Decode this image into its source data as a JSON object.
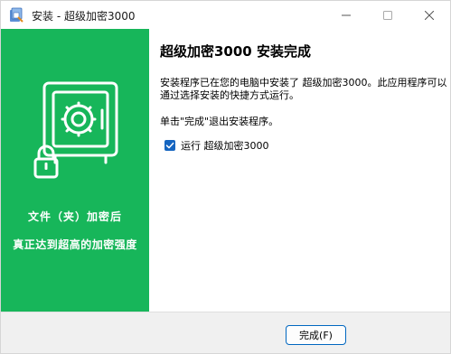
{
  "window": {
    "title": "安装 - 超级加密3000",
    "controls": [
      "minimize-icon",
      "maximize-icon",
      "close-icon"
    ]
  },
  "sidebar": {
    "background": "#17b65a",
    "icon": "safe-lock-icon",
    "line1": "文件（夹）加密后",
    "line2": "真正达到超高的加密强度"
  },
  "content": {
    "heading": "超级加密3000 安装完成",
    "description": "安装程序已在您的电脑中安装了 超级加密3000。此应用程序可以通过选择安装的快捷方式运行。",
    "instruction": "单击\"完成\"退出安装程序。",
    "run_checkbox": {
      "label": "运行 超级加密3000",
      "checked": true
    }
  },
  "footer": {
    "finish_label": "完成(F)"
  },
  "colors": {
    "accent": "#17b65a",
    "checkbox": "#1565c0",
    "button_border": "#0067c0"
  }
}
